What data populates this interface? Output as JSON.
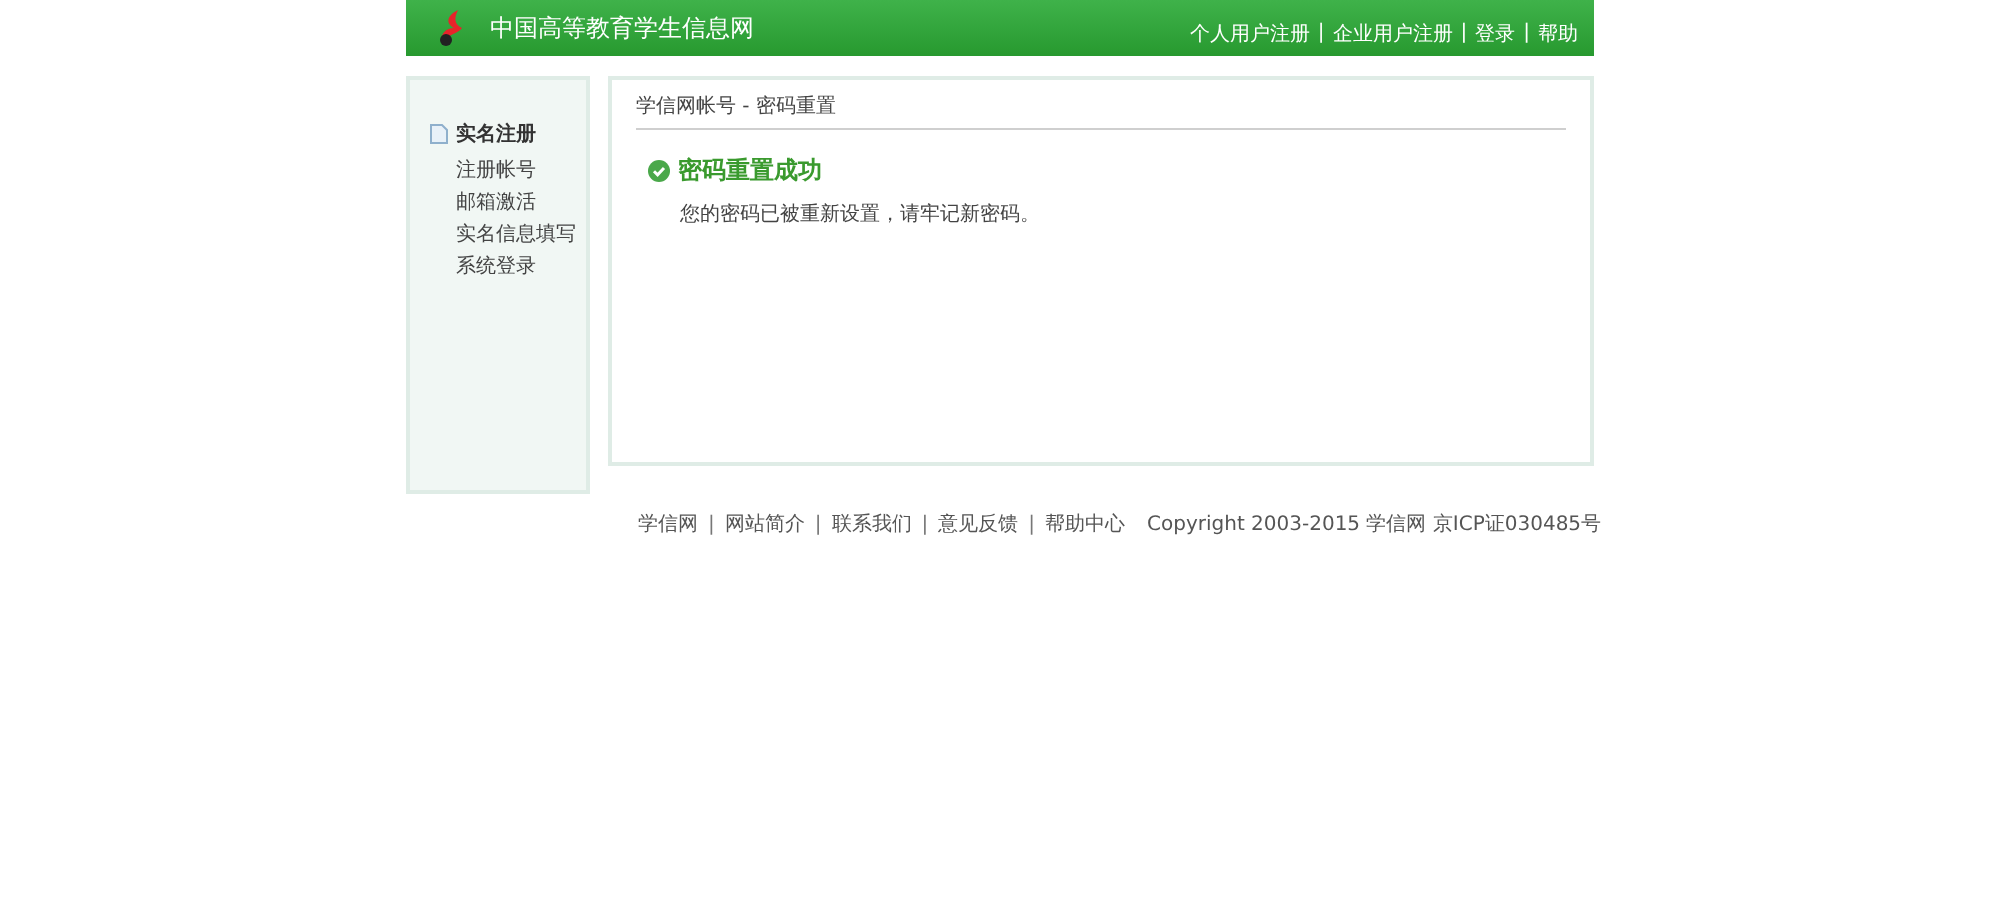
{
  "header": {
    "site_name": "中国高等教育学生信息网",
    "nav": [
      "个人用户注册",
      "企业用户注册",
      "登录",
      "帮助"
    ],
    "separator": "|"
  },
  "sidebar": {
    "title": "实名注册",
    "items": [
      "注册帐号",
      "邮箱激活",
      "实名信息填写",
      "系统登录"
    ]
  },
  "main": {
    "breadcrumb": "学信网帐号 - 密码重置",
    "heading": "密码重置成功",
    "message": "您的密码已被重新设置，请牢记新密码。"
  },
  "footer": {
    "links": [
      "学信网",
      "网站简介",
      "联系我们",
      "意见反馈",
      "帮助中心"
    ],
    "separator": "|",
    "copyright": "Copyright 2003-2015 学信网 京ICP证030485号"
  }
}
